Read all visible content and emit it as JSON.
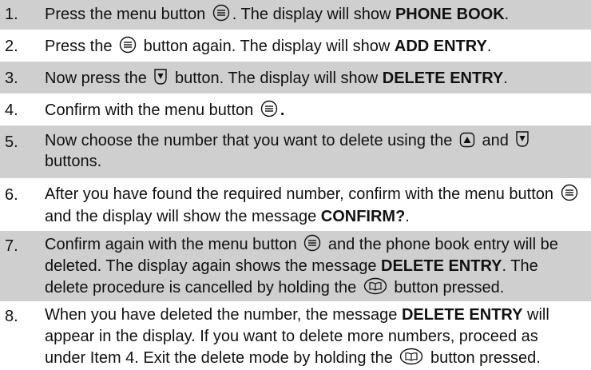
{
  "icons": {
    "menu": "menu-button-icon",
    "up": "up-arrow-button-icon",
    "down": "down-arrow-button-icon",
    "book": "phone-book-button-icon"
  },
  "steps": [
    {
      "number": "1.",
      "t1": "Press the menu button",
      "t2": ". The display will show",
      "b1": "PHONE BOOK",
      "t3": "."
    },
    {
      "number": "2.",
      "t1": "Press the",
      "t2": "button again. The display will show",
      "b1": "ADD ENTRY",
      "t3": "."
    },
    {
      "number": "3.",
      "t1": "Now press the",
      "t2": "button. The display will show",
      "b1": "DELETE ENTRY",
      "t3": "."
    },
    {
      "number": "4.",
      "t1": "Confirm with the menu button",
      "t2": "."
    },
    {
      "number": "5.",
      "t1": "Now choose the number that you want to delete using the",
      "t2": "and",
      "t3": "buttons."
    },
    {
      "number": "6.",
      "t1": "After you have found the required number, confirm with the menu button",
      "t2": "and the display will show the message",
      "b1": "CONFIRM?",
      "t3": "."
    },
    {
      "number": "7.",
      "t1": "Confirm again with the menu button",
      "t2": "and the phone book entry will be deleted. The display again shows the message",
      "b1": "DELETE ENTRY",
      "t3": ". The delete procedure is cancelled by holding the",
      "t4": "button pressed."
    },
    {
      "number": "8.",
      "t1": "When you have deleted the number, the message",
      "b1": "DELETE ENTRY",
      "t2": "will appear in the display. If you want to delete more numbers, proceed as under Item 4. Exit the delete mode by holding the",
      "t3": "button pressed."
    }
  ]
}
